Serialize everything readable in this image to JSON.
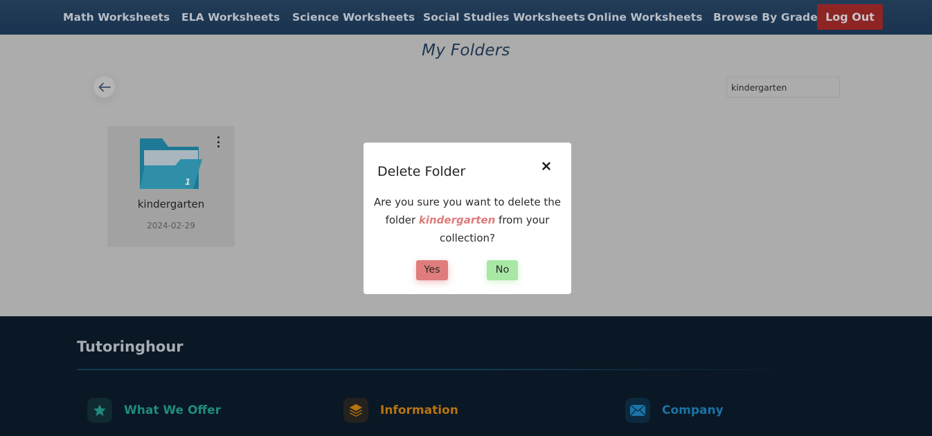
{
  "nav": {
    "items": [
      {
        "label": "Math Worksheets"
      },
      {
        "label": "ELA Worksheets"
      },
      {
        "label": "Science Worksheets"
      },
      {
        "label": "Social Studies Worksheets"
      },
      {
        "label": "Online Worksheets"
      },
      {
        "label": "Browse By Grade"
      }
    ],
    "logout_label": "Log Out"
  },
  "page": {
    "title": "My Folders",
    "search_value": "kindergarten"
  },
  "folders": [
    {
      "name": "kindergarten",
      "date": "2024-02-29",
      "count": "1"
    }
  ],
  "modal": {
    "title": "Delete Folder",
    "message_prefix": "Are you sure you want to delete the folder ",
    "folder_name": "kindergarten",
    "message_suffix": " from your collection?",
    "yes_label": "Yes",
    "no_label": "No"
  },
  "footer": {
    "brand": "Tutoringhour",
    "columns": [
      {
        "label": "What We Offer",
        "icon": "star-icon",
        "color": "#1f8b7e"
      },
      {
        "label": "Information",
        "icon": "layers-icon",
        "color": "#b8730f"
      },
      {
        "label": "Company",
        "icon": "envelope-icon",
        "color": "#1a74a8"
      }
    ]
  },
  "colors": {
    "nav_bg": "#1f3a55",
    "logout_bg": "#8e2424",
    "folder_blue": "#2f8fa8",
    "yes_bg": "#e07c7c",
    "no_bg": "#a8e8a4",
    "footer_bg": "#0a1724"
  }
}
